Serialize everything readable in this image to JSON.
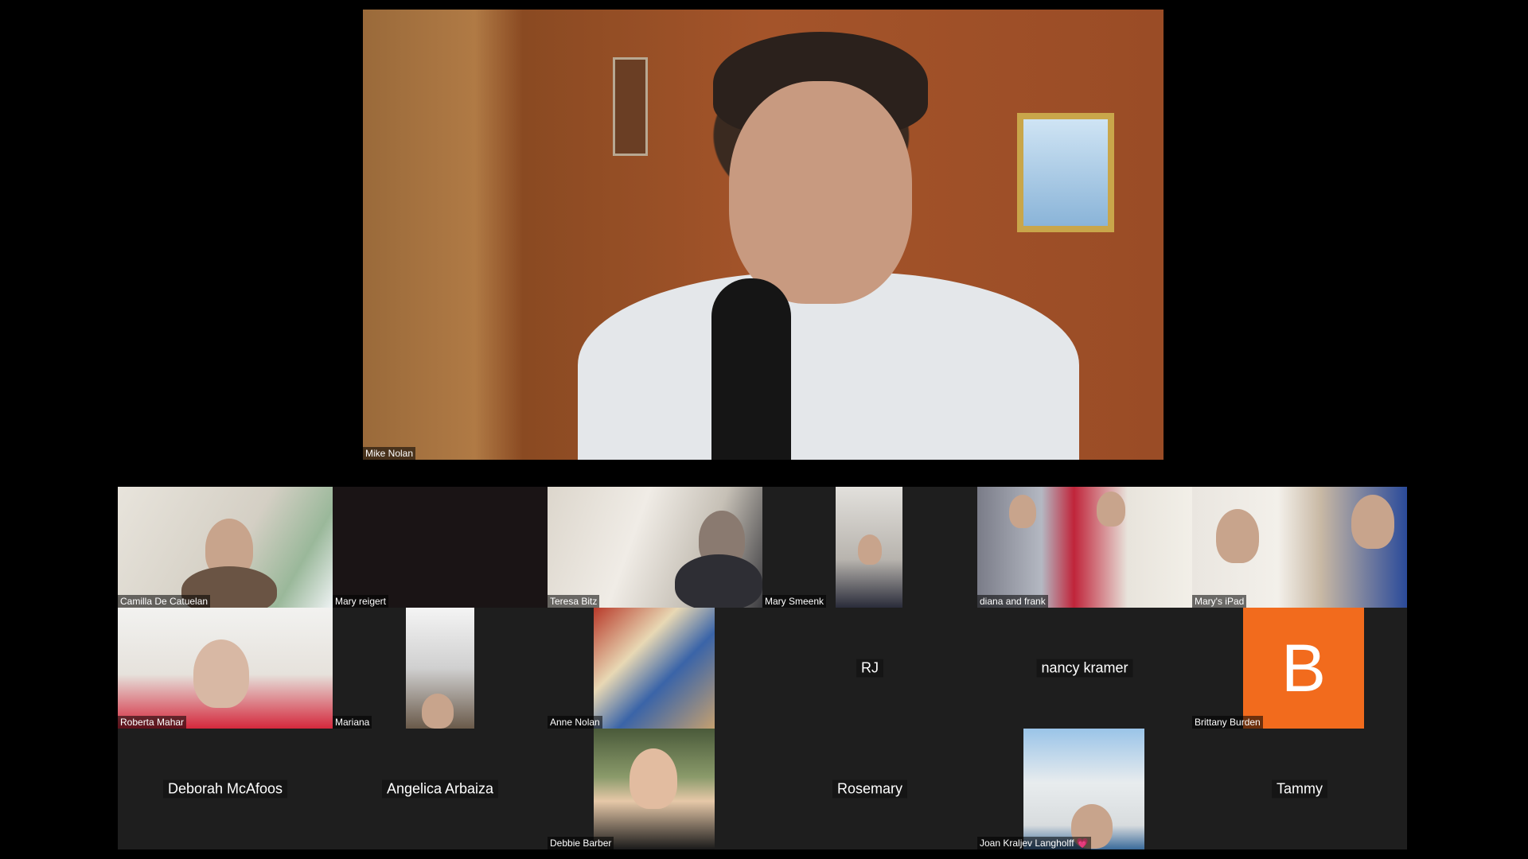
{
  "meeting": {
    "speaker": {
      "name": "Mike Nolan"
    },
    "participants": [
      {
        "name": "Camilla De Catuelan",
        "video": true
      },
      {
        "name": "Mary reigert",
        "video": false,
        "show_center": false
      },
      {
        "name": "Teresa Bitz",
        "video": true
      },
      {
        "name": "Mary Smeenk",
        "video": true
      },
      {
        "name": "diana and  frank",
        "video": true
      },
      {
        "name": "Mary's iPad",
        "video": true
      },
      {
        "name": "Roberta Mahar",
        "video": true
      },
      {
        "name": "Mariana",
        "video": true
      },
      {
        "name": "Anne Nolan",
        "video": true
      },
      {
        "name": "RJ",
        "video": false
      },
      {
        "name": "nancy kramer",
        "video": false
      },
      {
        "name": "Brittany Burden",
        "video": false,
        "avatar_letter": "B",
        "avatar_color": "#f26b1d"
      },
      {
        "name": "Deborah McAfoos",
        "video": false
      },
      {
        "name": "Angelica Arbaiza",
        "video": false
      },
      {
        "name": "Debbie Barber",
        "video": true
      },
      {
        "name": "Rosemary",
        "video": false
      },
      {
        "name": "Joan Kraljev Langholff",
        "video": true,
        "emoji": "💗"
      },
      {
        "name": "Tammy",
        "video": false
      }
    ]
  },
  "colors": {
    "background": "#000000",
    "tile": "#1e1e1e",
    "avatar_orange": "#f26b1d"
  }
}
